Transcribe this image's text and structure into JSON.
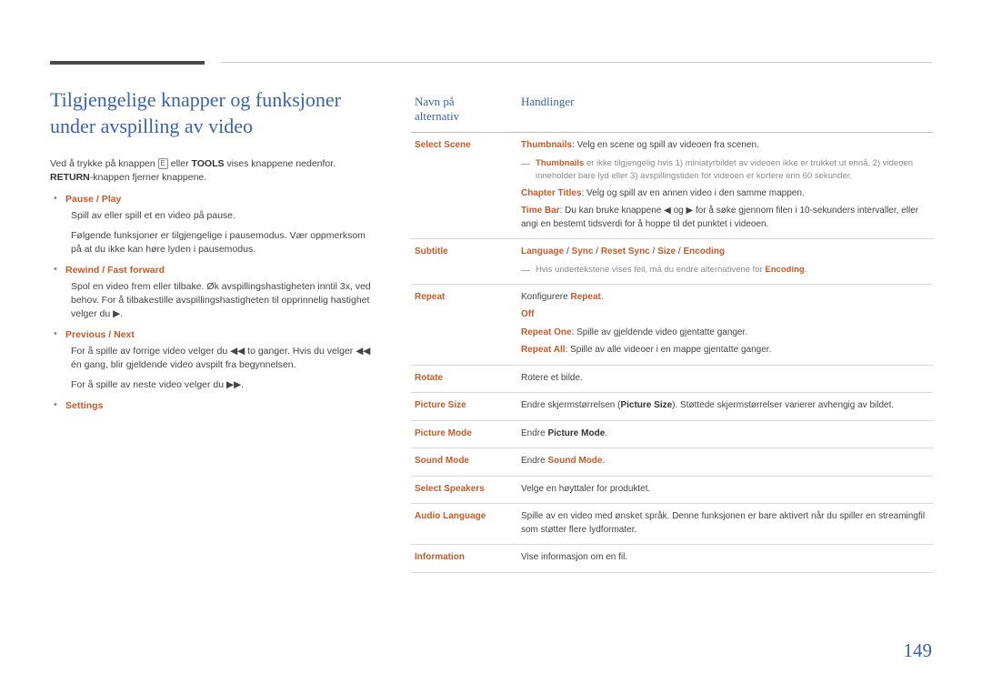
{
  "document": {
    "chapter_title": "Tilgjengelige knapper og funksjoner under avspilling av video",
    "page_number": "149",
    "intro_1_a": "Ved å trykke på knappen ",
    "intro_1_enter": "E",
    "intro_1_b": " eller ",
    "intro_1_tools": "TOOLS",
    "intro_1_c": " vises knappene nedenfor. ",
    "intro_1_return": "RETURN",
    "intro_1_d": "-knappen fjerner knappene."
  },
  "left_items": [
    {
      "title_parts": [
        "Pause",
        "/",
        "Play"
      ],
      "paragraphs": [
        "Spill av eller spill et en video på pause.",
        "Følgende funksjoner er tilgjengelige i pausemodus. Vær oppmerksom på at du ikke kan høre lyden i pausemodus."
      ]
    },
    {
      "title_parts": [
        "Rewind",
        "/",
        "Fast forward"
      ],
      "paragraphs": [
        "Spol en video frem eller tilbake. Øk avspillingshastigheten inntil 3x, ved behov. For å tilbakestille avspillingshastigheten til opprinnelig hastighet velger du ▶."
      ]
    },
    {
      "title_parts": [
        "Previous",
        "/",
        "Next"
      ],
      "paragraphs": [
        "For å spille av forrige video velger du ◀◀ to ganger. Hvis du velger ◀◀ én gang, blir gjeldende video avspilt fra begynnelsen.",
        "For å spille av neste video velger du ▶▶."
      ]
    },
    {
      "title_parts": [
        "Settings"
      ],
      "paragraphs": []
    }
  ],
  "table": {
    "headers": {
      "name": "Navn på alternativ",
      "actions": "Handlinger"
    },
    "rows": [
      {
        "name": "Select Scene",
        "lines": [
          {
            "type": "text",
            "segments": [
              {
                "t": "Thumbnails",
                "s": "kw"
              },
              {
                "t": ": Velg en scene og spill av videoen fra scenen.",
                "s": ""
              }
            ]
          },
          {
            "type": "note",
            "segments": [
              {
                "t": "Thumbnails",
                "s": "kw"
              },
              {
                "t": " er ikke tilgjengelig hvis 1) miniatyrbildet av videoen ikke er trukket ut ennå, 2) videoen inneholder bare lyd eller 3) avspillingstiden for videoen er kortere enn 60 sekunder.",
                "s": ""
              }
            ]
          },
          {
            "type": "text",
            "segments": [
              {
                "t": "Chapter Titles",
                "s": "kw"
              },
              {
                "t": ": Velg og spill av en annen video i den samme mappen.",
                "s": ""
              }
            ]
          },
          {
            "type": "text",
            "segments": [
              {
                "t": "Time Bar",
                "s": "kw"
              },
              {
                "t": ": Du kan bruke knappene ◀ og ▶ for å søke gjennom filen i 10-sekunders intervaller, eller angi en bestemt tidsverdi for å hoppe til det punktet i videoen.",
                "s": ""
              }
            ]
          }
        ]
      },
      {
        "name": "Subtitle",
        "lines": [
          {
            "type": "text",
            "segments": [
              {
                "t": "Language",
                "s": "kw"
              },
              {
                "t": " / ",
                "s": ""
              },
              {
                "t": "Sync",
                "s": "kw"
              },
              {
                "t": " / ",
                "s": ""
              },
              {
                "t": "Reset Sync",
                "s": "kw"
              },
              {
                "t": " / ",
                "s": ""
              },
              {
                "t": "Size",
                "s": "kw"
              },
              {
                "t": " / ",
                "s": ""
              },
              {
                "t": "Encoding",
                "s": "kw"
              }
            ]
          },
          {
            "type": "note",
            "segments": [
              {
                "t": "Hvis undertekstene vises feil, må du endre alternativene for ",
                "s": ""
              },
              {
                "t": "Encoding",
                "s": "kw"
              },
              {
                "t": ".",
                "s": ""
              }
            ]
          }
        ]
      },
      {
        "name": "Repeat",
        "lines": [
          {
            "type": "text",
            "segments": [
              {
                "t": "Konfigurere ",
                "s": ""
              },
              {
                "t": "Repeat",
                "s": "kw"
              },
              {
                "t": ".",
                "s": ""
              }
            ]
          },
          {
            "type": "text",
            "segments": [
              {
                "t": "Off",
                "s": "kw"
              }
            ]
          },
          {
            "type": "text",
            "segments": [
              {
                "t": "Repeat One",
                "s": "kw"
              },
              {
                "t": ": Spille av gjeldende video gjentatte ganger.",
                "s": ""
              }
            ]
          },
          {
            "type": "text",
            "segments": [
              {
                "t": "Repeat All",
                "s": "kw"
              },
              {
                "t": ": Spille av alle videoer i en mappe gjentatte ganger.",
                "s": ""
              }
            ]
          }
        ]
      },
      {
        "name": "Rotate",
        "lines": [
          {
            "type": "text",
            "segments": [
              {
                "t": "Rotere et bilde.",
                "s": ""
              }
            ]
          }
        ]
      },
      {
        "name": "Picture Size",
        "lines": [
          {
            "type": "text",
            "segments": [
              {
                "t": "Endre skjermstørrelsen (",
                "s": ""
              },
              {
                "t": "Picture Size",
                "s": "kb"
              },
              {
                "t": "). Støttede skjermstørrelser varierer avhengig av bildet.",
                "s": ""
              }
            ]
          }
        ]
      },
      {
        "name": "Picture Mode",
        "lines": [
          {
            "type": "text",
            "segments": [
              {
                "t": "Endre ",
                "s": ""
              },
              {
                "t": "Picture Mode",
                "s": "kb"
              },
              {
                "t": ".",
                "s": ""
              }
            ]
          }
        ]
      },
      {
        "name": "Sound Mode",
        "lines": [
          {
            "type": "text",
            "segments": [
              {
                "t": "Endre ",
                "s": ""
              },
              {
                "t": "Sound Mode",
                "s": "kw"
              },
              {
                "t": ".",
                "s": ""
              }
            ]
          }
        ]
      },
      {
        "name": "Select Speakers",
        "lines": [
          {
            "type": "text",
            "segments": [
              {
                "t": "Velge en høyttaler for produktet.",
                "s": ""
              }
            ]
          }
        ]
      },
      {
        "name": "Audio Language",
        "lines": [
          {
            "type": "text",
            "segments": [
              {
                "t": "Spille av en video med ønsket språk. Denne funksjonen er bare aktivert når du spiller en streamingfil som støtter flere lydformater.",
                "s": ""
              }
            ]
          }
        ]
      },
      {
        "name": "Information",
        "lines": [
          {
            "type": "text",
            "segments": [
              {
                "t": "Vise informasjon om en fil.",
                "s": ""
              }
            ]
          }
        ]
      }
    ]
  }
}
